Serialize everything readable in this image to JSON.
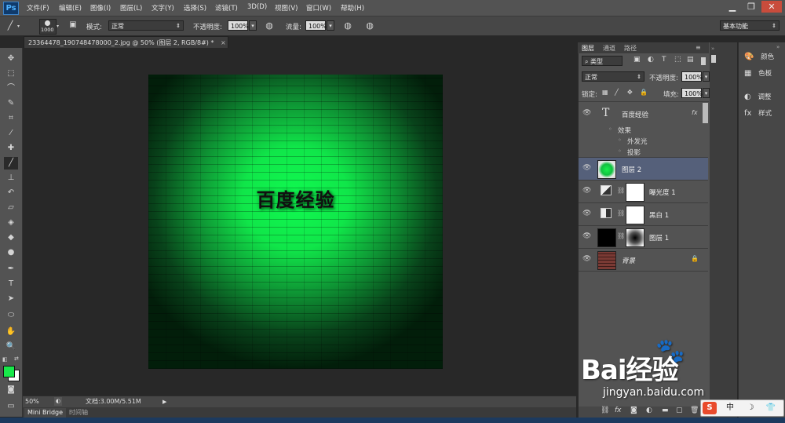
{
  "app": {
    "logo": "Ps"
  },
  "menu": [
    "文件(F)",
    "编辑(E)",
    "图像(I)",
    "图层(L)",
    "文字(Y)",
    "选择(S)",
    "滤镜(T)",
    "3D(D)",
    "视图(V)",
    "窗口(W)",
    "帮助(H)"
  ],
  "window_controls": {
    "minimize": "▁",
    "restore": "❐",
    "close": "✕"
  },
  "options": {
    "brush_size": "1000",
    "mode_label": "模式:",
    "mode_value": "正常",
    "opacity_label": "不透明度:",
    "opacity_value": "100%",
    "flow_label": "流量:",
    "flow_value": "100%",
    "workspace": "基本功能"
  },
  "document": {
    "tab_title": "23364478_190748478000_2.jpg @ 50% (图层 2, RGB/8#) *",
    "canvas_text": "百度经验"
  },
  "status": {
    "zoom": "50%",
    "doc_info": "文档:3.00M/5.51M"
  },
  "bottom_tabs": [
    "Mini Bridge",
    "时间轴"
  ],
  "layers_panel": {
    "tabs": [
      "图层",
      "通道",
      "路径"
    ],
    "filter_kind": "类型",
    "blend_mode": "正常",
    "opacity_label": "不透明度:",
    "opacity_value": "100%",
    "lock_label": "锁定:",
    "fill_label": "填充:",
    "fill_value": "100%",
    "layers": [
      {
        "name": "百度经验",
        "kind": "text",
        "fx": "fx"
      },
      {
        "name": "图层 2",
        "kind": "green-glow",
        "selected": true
      },
      {
        "name": "曝光度 1",
        "kind": "adjustment"
      },
      {
        "name": "黑白 1",
        "kind": "adjustment"
      },
      {
        "name": "图层 1",
        "kind": "masked"
      },
      {
        "name": "背景",
        "kind": "background",
        "locked": true
      }
    ],
    "effects_label": "效果",
    "effects": [
      "外发光",
      "投影"
    ]
  },
  "dock": [
    {
      "label": "颜色",
      "icon": "palette-icon"
    },
    {
      "label": "色板",
      "icon": "swatches-icon"
    },
    {
      "label": "调整",
      "icon": "adjustments-icon"
    },
    {
      "label": "样式",
      "icon": "styles-icon"
    }
  ],
  "watermark": {
    "brand": "Bai经验",
    "url": "jingyan.baidu.com"
  },
  "ime": {
    "items": [
      "S",
      "中",
      "☽",
      "👕"
    ]
  },
  "colors": {
    "foreground": "#18e84a",
    "background": "#ffffff",
    "selected_layer": "#55607a"
  }
}
